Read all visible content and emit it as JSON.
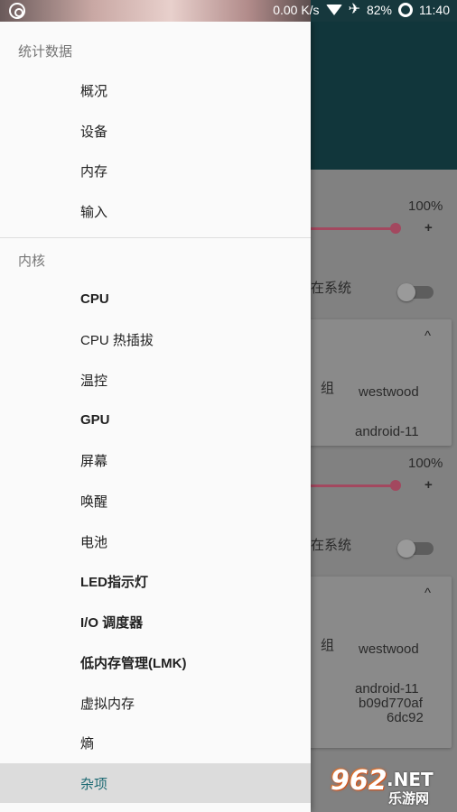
{
  "status_bar": {
    "network_speed": "0.00 K/s",
    "battery": "82%",
    "time": "11:40"
  },
  "background": {
    "percent_1": "100%",
    "plus_1": "+",
    "system_label_1": "在系统",
    "group_label_1": "组",
    "governor_1": "westwood",
    "build_1": "android-11",
    "percent_2": "100%",
    "plus_2": "+",
    "system_label_2": "在系统",
    "group_label_2": "组",
    "governor_2": "westwood",
    "build_2": "android-11",
    "build_2b": "b09d770af",
    "build_2c": "6dc92",
    "chevron": "^"
  },
  "drawer": {
    "section_stats": "统计数据",
    "section_kernel": "内核",
    "items": {
      "overview": "概况",
      "device": "设备",
      "memory": "内存",
      "input": "输入",
      "cpu": "CPU",
      "cpu_hotplug": "CPU 热插拔",
      "thermal": "温控",
      "gpu": "GPU",
      "screen": "屏幕",
      "wake": "唤醒",
      "battery": "电池",
      "led": "LED指示灯",
      "io": "I/O 调度器",
      "lmk": "低内存管理(LMK)",
      "vm": "虚拟内存",
      "entropy": "熵",
      "misc": "杂项"
    }
  },
  "watermark": {
    "digits": "962",
    "net": ".NET",
    "site": "乐游网"
  }
}
